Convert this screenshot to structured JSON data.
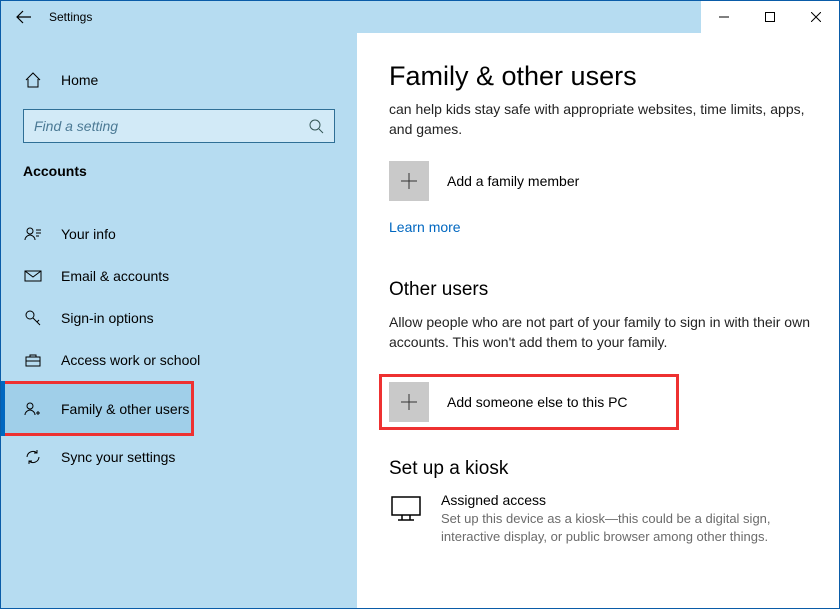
{
  "window": {
    "title": "Settings"
  },
  "sidebar": {
    "home_label": "Home",
    "search_placeholder": "Find a setting",
    "category": "Accounts",
    "items": [
      {
        "label": "Your info"
      },
      {
        "label": "Email & accounts"
      },
      {
        "label": "Sign-in options"
      },
      {
        "label": "Access work or school"
      },
      {
        "label": "Family & other users"
      },
      {
        "label": "Sync your settings"
      }
    ]
  },
  "content": {
    "page_title": "Family & other users",
    "intro": "can help kids stay safe with appropriate websites, time limits, apps, and games.",
    "add_family_label": "Add a family member",
    "learn_more": "Learn more",
    "other_users_heading": "Other users",
    "other_users_desc": "Allow people who are not part of your family to sign in with their own accounts. This won't add them to your family.",
    "add_other_label": "Add someone else to this PC",
    "kiosk_heading": "Set up a kiosk",
    "assigned_title": "Assigned access",
    "assigned_sub": "Set up this device as a kiosk—this could be a digital sign, interactive display, or public browser among other things."
  }
}
